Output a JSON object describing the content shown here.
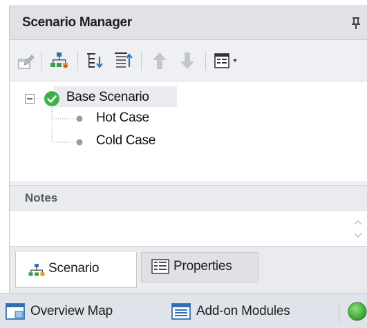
{
  "panel": {
    "title": "Scenario Manager",
    "pin_icon": "pin-icon"
  },
  "toolbar": {
    "buttons": [
      {
        "icon": "edit-scenario-icon",
        "enabled": false
      },
      {
        "icon": "scenario-tree-icon",
        "enabled": true
      },
      {
        "icon": "expand-all-icon",
        "enabled": true
      },
      {
        "icon": "collapse-all-icon",
        "enabled": true
      },
      {
        "icon": "move-up-icon",
        "enabled": false
      },
      {
        "icon": "move-down-icon",
        "enabled": false
      },
      {
        "icon": "view-options-dropdown-icon",
        "enabled": true
      }
    ]
  },
  "tree": {
    "root": {
      "label": "Base Scenario",
      "status": "current",
      "expanded": true
    },
    "children": [
      {
        "label": "Hot Case"
      },
      {
        "label": "Cold Case"
      }
    ]
  },
  "notes": {
    "header": "Notes",
    "value": ""
  },
  "tabs": [
    {
      "label": "Scenario",
      "active": true
    },
    {
      "label": "Properties",
      "active": false
    }
  ],
  "bottom_bar": {
    "overview_map": "Overview Map",
    "addon_modules": "Add-on Modules"
  },
  "colors": {
    "status_green": "#3cb34a",
    "accent_blue": "#2f6fb5",
    "header_bg": "#e1e2e6"
  }
}
